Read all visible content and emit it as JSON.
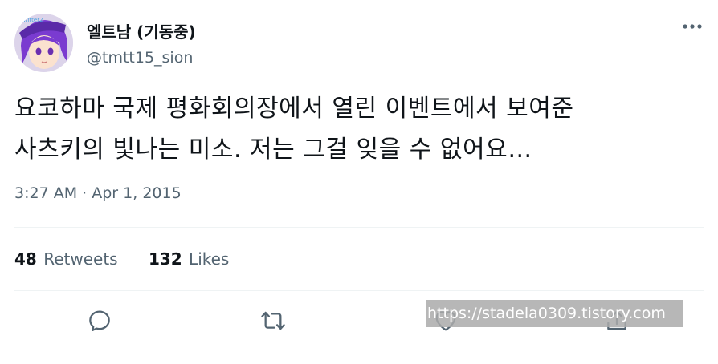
{
  "author": {
    "display_name": "엘트남 (기동중)",
    "handle": "@tmtt15_sion",
    "avatar_text": "twitter2"
  },
  "tweet": {
    "text": "요코하마 국제 평화회의장에서 열린 이벤트에서 보여준\n사츠키의 빛나는 미소. 저는 그걸 잊을 수 없어요…",
    "time": "3:27 AM",
    "separator": "·",
    "date": "Apr 1, 2015"
  },
  "stats": {
    "retweets_count": "48",
    "retweets_label": "Retweets",
    "likes_count": "132",
    "likes_label": "Likes"
  },
  "actions": {
    "icons": [
      "reply-icon",
      "retweet-icon",
      "like-icon",
      "share-icon"
    ]
  },
  "watermark": {
    "text": "https://stadela0309.tistory.com"
  },
  "colors": {
    "text_primary": "#0f1419",
    "text_secondary": "#536471",
    "divider": "#eff3f4",
    "icon": "#536471"
  }
}
